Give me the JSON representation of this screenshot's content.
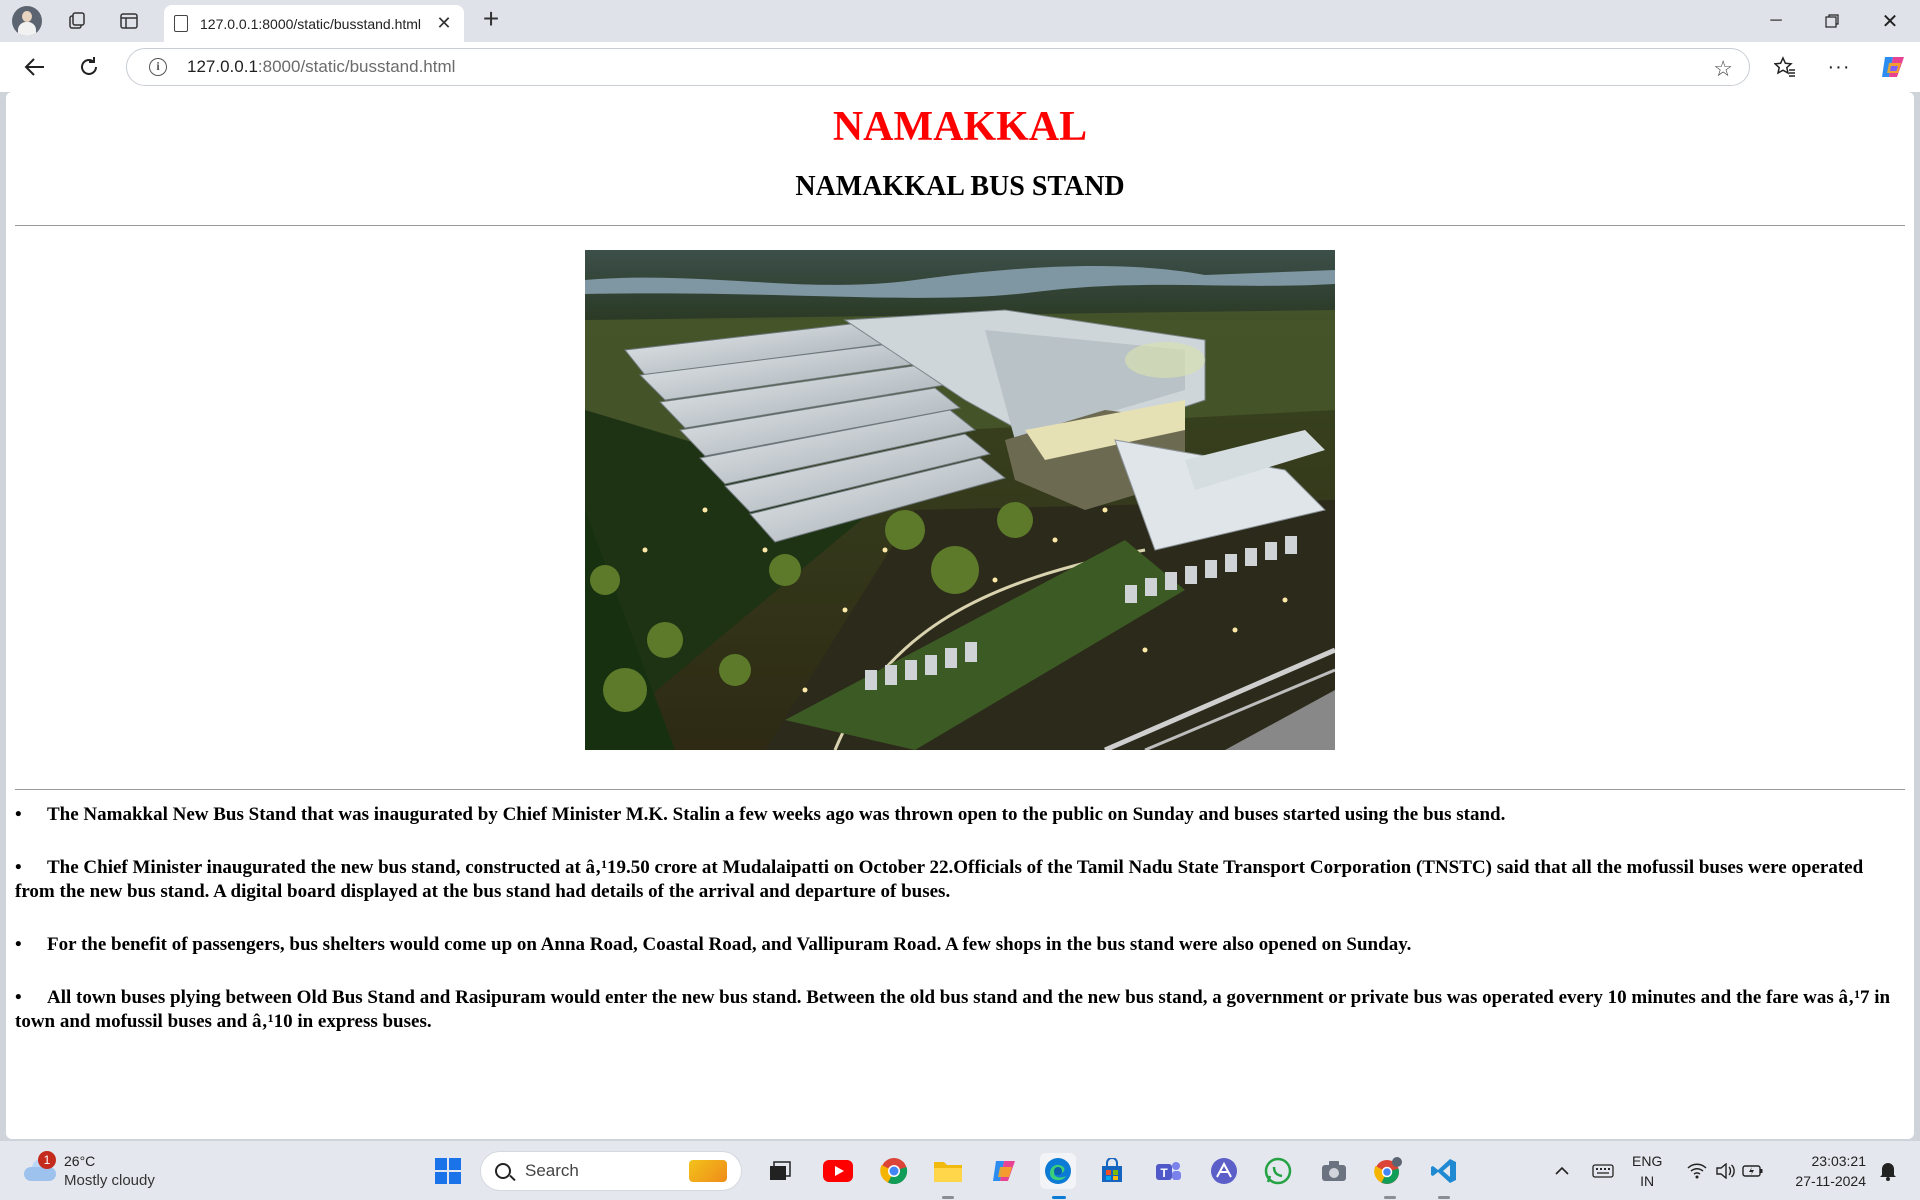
{
  "browser": {
    "tab": {
      "title": "127.0.0.1:8000/static/busstand.html"
    },
    "address": {
      "host": "127.0.0.1",
      "rest": ":8000/static/busstand.html"
    }
  },
  "page": {
    "city": "NAMAKKAL",
    "heading": "NAMAKKAL BUS STAND",
    "image_alt": "Namakkal bus terminal aerial rendering",
    "bullet_glyph": "•",
    "bullets": [
      "The Namakkal New Bus Stand that was inaugurated by Chief Minister M.K. Stalin a few weeks ago was thrown open to the public on Sunday and buses started using the bus stand.",
      "The Chief Minister inaugurated the new bus stand, constructed at â‚¹19.50 crore at Mudalaipatti on October 22.Officials of the Tamil Nadu State Transport Corporation (TNSTC) said that all the mofussil buses were operated from the new bus stand. A digital board displayed at the bus stand had details of the arrival and departure of buses.",
      "For the benefit of passengers, bus shelters would come up on Anna Road, Coastal Road, and Vallipuram Road. A few shops in the bus stand were also opened on Sunday.",
      "All town buses plying between Old Bus Stand and Rasipuram would enter the new bus stand. Between the old bus stand and the new bus stand, a government or private bus was operated every 10 minutes and the fare was â‚¹7 in town and mofussil buses and â‚¹10 in express buses."
    ]
  },
  "taskbar": {
    "weather": {
      "badge": "1",
      "temp": "26°C",
      "condition": "Mostly cloudy"
    },
    "search_placeholder": "Search",
    "lang": {
      "line1": "ENG",
      "line2": "IN"
    },
    "clock": {
      "time": "23:03:21",
      "date": "27-11-2024"
    }
  },
  "colors": {
    "city_red": "#ff0000",
    "edge_blue": "#0c7bd6"
  },
  "icons": [
    "profile-avatar",
    "workspaces-icon",
    "tab-actions-icon",
    "page-icon",
    "back-icon",
    "reload-icon",
    "info-icon",
    "favorite-star-icon",
    "favorites-icon",
    "more-icon",
    "copilot-icon",
    "windows-start-icon",
    "task-view-icon",
    "youtube-icon",
    "chrome-icon",
    "file-explorer-icon",
    "copilot-app-icon",
    "edge-icon",
    "store-icon",
    "teams-icon",
    "app-icon",
    "whatsapp-icon",
    "camera-icon",
    "chrome-profile-icon",
    "vscode-icon",
    "chevron-up-icon",
    "keyboard-icon",
    "wifi-icon",
    "volume-icon",
    "battery-icon",
    "notification-bell-icon"
  ]
}
